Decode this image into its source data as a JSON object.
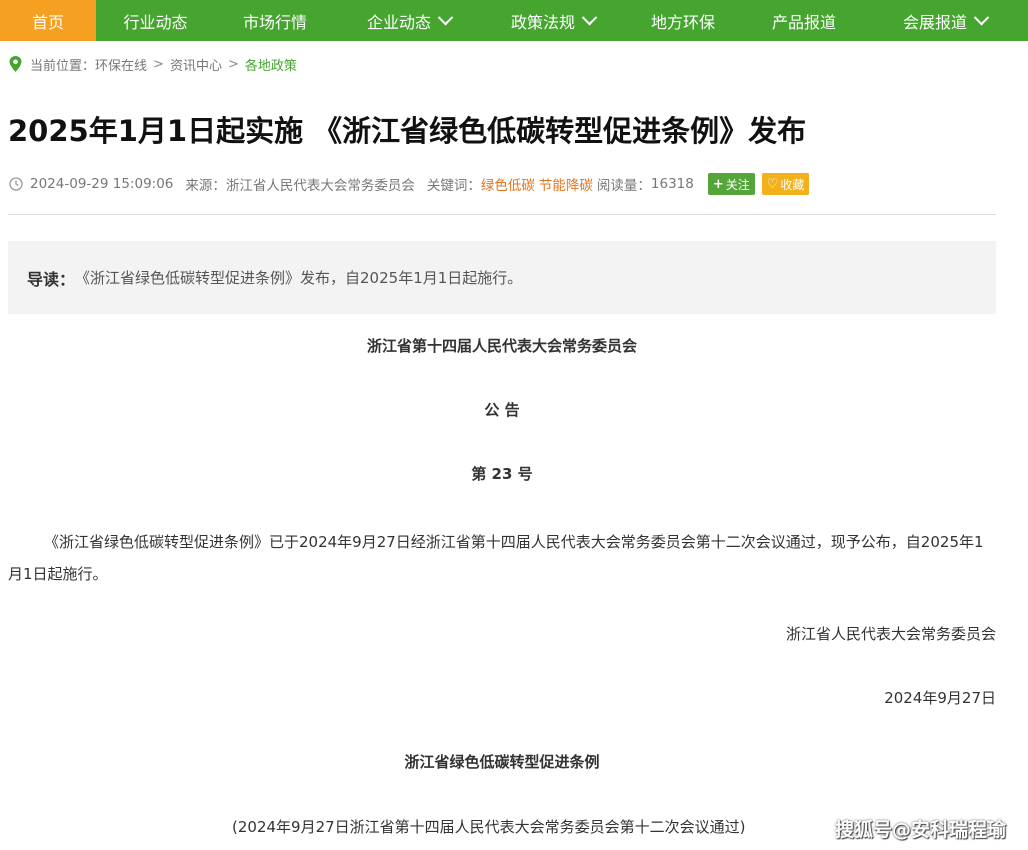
{
  "nav": {
    "items": [
      {
        "label": "首页",
        "has_dropdown": false,
        "active": true
      },
      {
        "label": "行业动态",
        "has_dropdown": false,
        "active": false
      },
      {
        "label": "市场行情",
        "has_dropdown": false,
        "active": false
      },
      {
        "label": "企业动态",
        "has_dropdown": true,
        "active": false
      },
      {
        "label": "政策法规",
        "has_dropdown": true,
        "active": false
      },
      {
        "label": "地方环保",
        "has_dropdown": false,
        "active": false
      },
      {
        "label": "产品报道",
        "has_dropdown": false,
        "active": false
      },
      {
        "label": "会展报道",
        "has_dropdown": true,
        "active": false
      }
    ]
  },
  "breadcrumb": {
    "prefix": "当前位置：",
    "items": [
      "环保在线",
      "资讯中心",
      "各地政策"
    ],
    "separator": ">"
  },
  "article": {
    "title": "2025年1月1日起实施 《浙江省绿色低碳转型促进条例》发布",
    "datetime": "2024-09-29 15:09:06",
    "source_label": "来源：",
    "source": "浙江省人民代表大会常务委员会",
    "keywords_label": "关键词：",
    "keywords": [
      "绿色低碳",
      "节能降碳"
    ],
    "views_label": "阅读量：",
    "views": "16318",
    "follow_label": "关注",
    "favorite_label": "收藏",
    "summary_lead": "导读：",
    "summary_text": "《浙江省绿色低碳转型促进条例》发布，自2025年1月1日起施行。",
    "body": {
      "committee": "浙江省第十四届人民代表大会常务委员会",
      "notice": "公 告",
      "number": "第 23 号",
      "paragraph": "《浙江省绿色低碳转型促进条例》已于2024年9月27日经浙江省第十四届人民代表大会常务委员会第十二次会议通过，现予公布，自2025年1月1日起施行。",
      "signature": "浙江省人民代表大会常务委员会",
      "sign_date": "2024年9月27日",
      "law_title": "浙江省绿色低碳转型促进条例",
      "law_note": "(2024年9月27日浙江省第十四届人民代表大会常务委员会第十二次会议通过)"
    }
  },
  "watermark": "搜狐号@安科瑞程瑜",
  "colors": {
    "nav_bg": "#45a52f",
    "nav_active": "#f5a020",
    "keyword": "#e3751e",
    "follow_btn": "#55a53a",
    "favorite_btn": "#f2b01b"
  }
}
